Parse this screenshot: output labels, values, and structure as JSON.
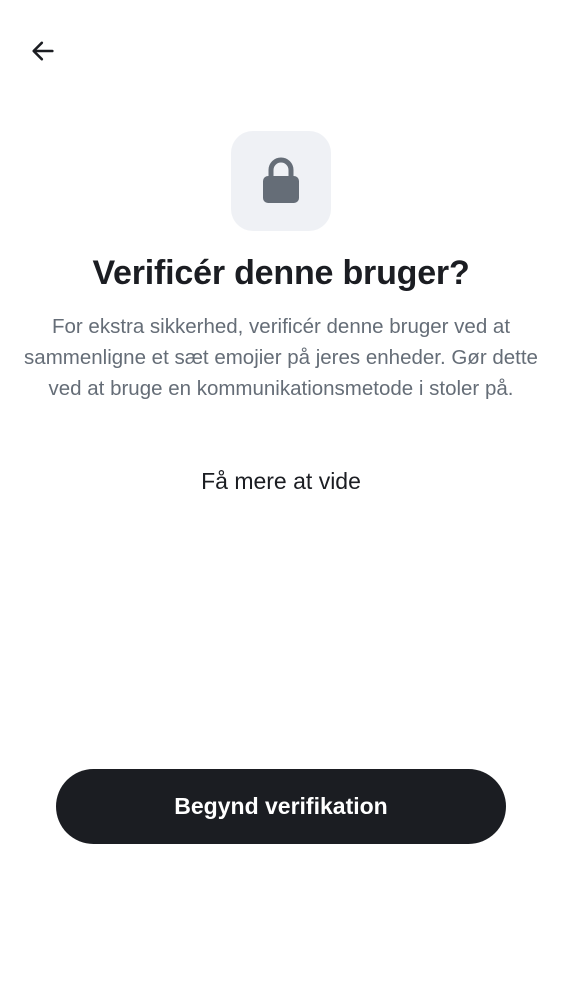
{
  "header": {
    "back_icon": "arrow-left-icon"
  },
  "hero": {
    "icon": "lock-icon",
    "icon_color": "#656d77",
    "tile_color": "#eff1f5"
  },
  "title": "Verificér denne bruger?",
  "description": "For ekstra sikkerhed, verificér denne bruger ved at sammenligne et sæt emojier på jeres enheder. Gør dette ved at bruge en kommunikationsmetode i stoler på.",
  "learn_more_label": "Få mere at vide",
  "primary_button": {
    "label": "Begynd verifikation",
    "background": "#1b1d22",
    "text_color": "#ffffff"
  }
}
